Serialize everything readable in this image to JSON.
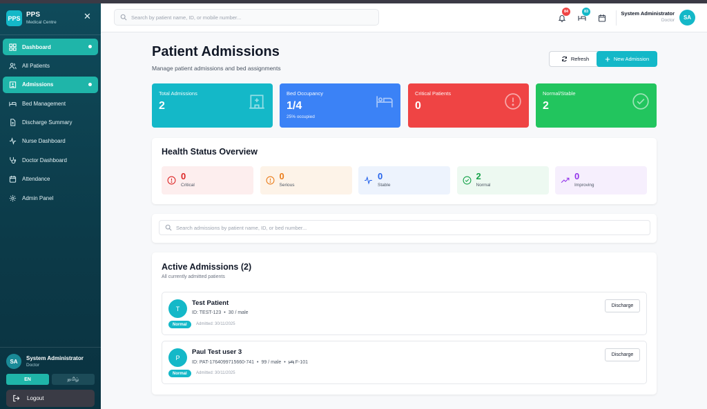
{
  "brand": {
    "logo": "PPS",
    "title": "PPS",
    "subtitle": "Medical Centre"
  },
  "sidebar": {
    "items": [
      {
        "label": "Dashboard",
        "icon": "grid-icon",
        "active": true
      },
      {
        "label": "All Patients",
        "icon": "users-icon",
        "active": false
      },
      {
        "label": "Admissions",
        "icon": "hospital-icon",
        "active": true
      },
      {
        "label": "Bed Management",
        "icon": "bed-icon",
        "active": false
      },
      {
        "label": "Discharge Summary",
        "icon": "document-icon",
        "active": false
      },
      {
        "label": "Nurse Dashboard",
        "icon": "activity-icon",
        "active": false
      },
      {
        "label": "Doctor Dashboard",
        "icon": "stethoscope-icon",
        "active": false
      },
      {
        "label": "Attendance",
        "icon": "calendar-icon",
        "active": false
      },
      {
        "label": "Admin Panel",
        "icon": "gear-icon",
        "active": false
      }
    ],
    "user": {
      "initials": "SA",
      "name": "System Administrator",
      "role": "Doctor"
    },
    "lang": {
      "en": "EN",
      "ta": "தமிழ்"
    },
    "logout": "Logout"
  },
  "header": {
    "search_placeholder": "Search by patient name, ID, or mobile number...",
    "notifications_count": "84",
    "beds_count": "83",
    "user": {
      "name": "System Administrator",
      "role": "Doctor",
      "initials": "SA"
    }
  },
  "page": {
    "title": "Patient Admissions",
    "subtitle": "Manage patient admissions and bed assignments",
    "refresh_label": "Refresh",
    "new_admission_label": "New Admission"
  },
  "stats": [
    {
      "label": "Total Admissions",
      "value": "2",
      "note": "",
      "color": "#14b8c8",
      "icon": "hospital-icon"
    },
    {
      "label": "Bed Occupancy",
      "value": "1/4",
      "note": "25% occupied",
      "color": "#3b82f6",
      "icon": "bed-icon"
    },
    {
      "label": "Critical Patients",
      "value": "0",
      "note": "",
      "color": "#ef4444",
      "icon": "alert-icon"
    },
    {
      "label": "Normal/Stable",
      "value": "2",
      "note": "",
      "color": "#22c55e",
      "icon": "check-circle-icon"
    }
  ],
  "health": {
    "title": "Health Status Overview",
    "tiles": [
      {
        "value": "0",
        "label": "Critical",
        "color": "#dc2626",
        "bg": "#fdeeee"
      },
      {
        "value": "0",
        "label": "Serious",
        "color": "#ea7c1a",
        "bg": "#fdf3e8"
      },
      {
        "value": "0",
        "label": "Stable",
        "color": "#2563eb",
        "bg": "#edf3fd"
      },
      {
        "value": "2",
        "label": "Normal",
        "color": "#16a34a",
        "bg": "#edf9f1"
      },
      {
        "value": "0",
        "label": "Improving",
        "color": "#9333ea",
        "bg": "#f6effd"
      }
    ]
  },
  "admissions_search": {
    "placeholder": "Search admissions by patient name, ID, or bed number..."
  },
  "active": {
    "title": "Active Admissions (2)",
    "subtitle": "All currently admitted patients",
    "patients": [
      {
        "initial": "T",
        "name": "Test Patient",
        "id": "ID: TEST-123",
        "age_gender": "30 / male",
        "bed": "",
        "status": "Normal",
        "admitted": "Admitted: 30/11/2025",
        "discharge_label": "Discharge"
      },
      {
        "initial": "P",
        "name": "Paul Test user 3",
        "id": "ID: PAT-1764099715660-741",
        "age_gender": "99 / male",
        "bed": "F-101",
        "status": "Normal",
        "admitted": "Admitted: 30/11/2025",
        "discharge_label": "Discharge"
      }
    ]
  }
}
